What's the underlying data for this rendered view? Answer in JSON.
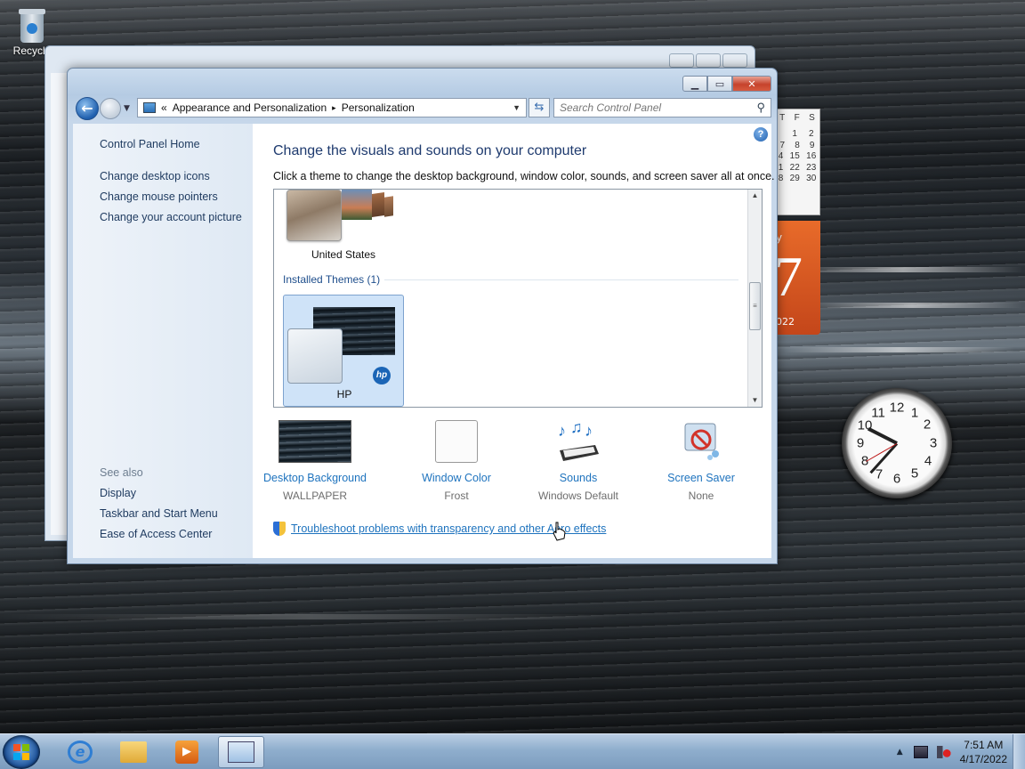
{
  "desktop": {
    "recycle_label": "Recycle"
  },
  "calendar_gadget": {
    "day_headers": [
      "T",
      "F",
      "S"
    ],
    "rows": [
      [
        "",
        "1",
        "2"
      ],
      [
        "7",
        "8",
        "9"
      ],
      [
        "4",
        "15",
        "16"
      ],
      [
        "1",
        "22",
        "23"
      ],
      [
        "8",
        "29",
        "30"
      ]
    ],
    "partial_day_name": "y",
    "big_day": "7",
    "year": "022"
  },
  "clock_gadget": {
    "numbers": [
      "12",
      "1",
      "2",
      "3",
      "4",
      "5",
      "6",
      "7",
      "8",
      "9",
      "10",
      "11"
    ]
  },
  "window": {
    "address": {
      "chevron": "«",
      "crumb1": "Appearance and Personalization",
      "sep": "▸",
      "crumb2": "Personalization"
    },
    "search_placeholder": "Search Control Panel",
    "sidebar": {
      "home": "Control Panel Home",
      "links": [
        "Change desktop icons",
        "Change mouse pointers",
        "Change your account picture"
      ],
      "see_also_label": "See also",
      "see_also": [
        "Display",
        "Taskbar and Start Menu",
        "Ease of Access Center"
      ]
    },
    "heading": "Change the visuals and sounds on your computer",
    "subheading": "Click a theme to change the desktop background, window color, sounds, and screen saver all at once.",
    "themes": {
      "us_label": "United States",
      "installed_header": "Installed Themes (1)",
      "hp_label": "HP",
      "hp_logo": "hp"
    },
    "options": [
      {
        "title": "Desktop Background",
        "value": "WALLPAPER"
      },
      {
        "title": "Window Color",
        "value": "Frost"
      },
      {
        "title": "Sounds",
        "value": "Windows Default"
      },
      {
        "title": "Screen Saver",
        "value": "None"
      }
    ],
    "troubleshoot_link": "Troubleshoot problems with transparency and other Aero effects"
  },
  "taskbar": {
    "time": "7:51 AM",
    "date": "4/17/2022"
  }
}
